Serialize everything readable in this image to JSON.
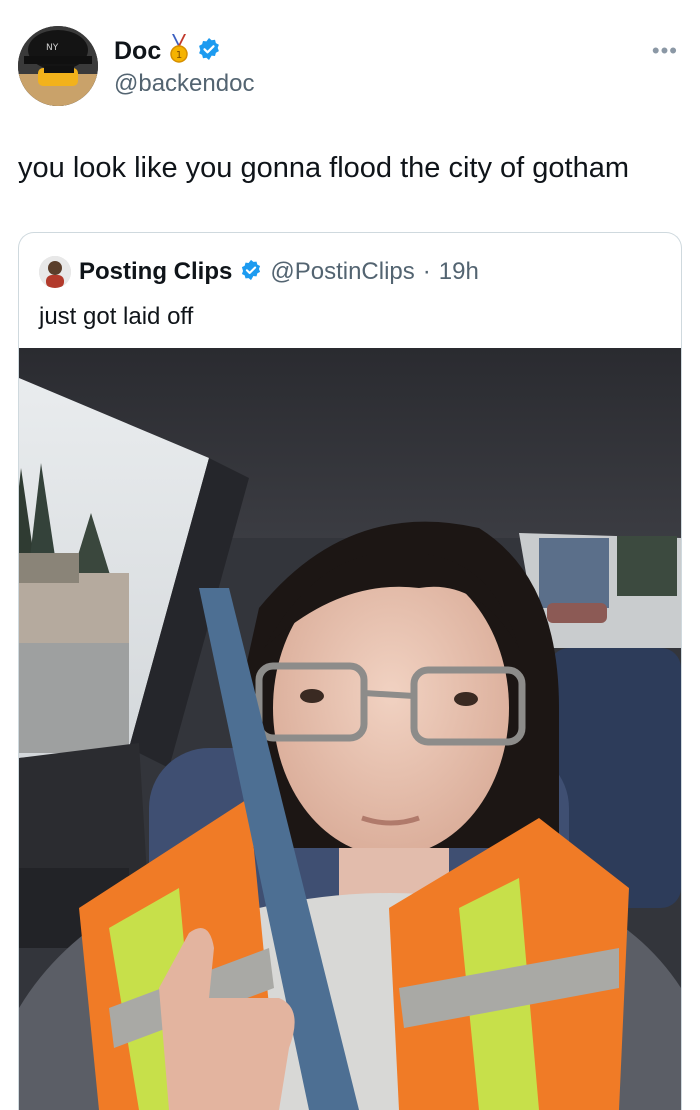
{
  "tweet": {
    "display_name": "Doc",
    "handle": "@backendoc",
    "more_label": "•••",
    "text": "you look like you gonna flood the city of gotham",
    "icons": [
      "medal-icon",
      "verified-icon",
      "more-icon"
    ]
  },
  "quoted_tweet": {
    "display_name": "Posting Clips",
    "handle": "@PostinClips",
    "separator": "·",
    "time": "19h",
    "text": "just got laid off",
    "media": "selfie-photo"
  },
  "colors": {
    "verified": "#1d9bf0",
    "secondary_text": "#536471",
    "border": "#cfd9de"
  }
}
